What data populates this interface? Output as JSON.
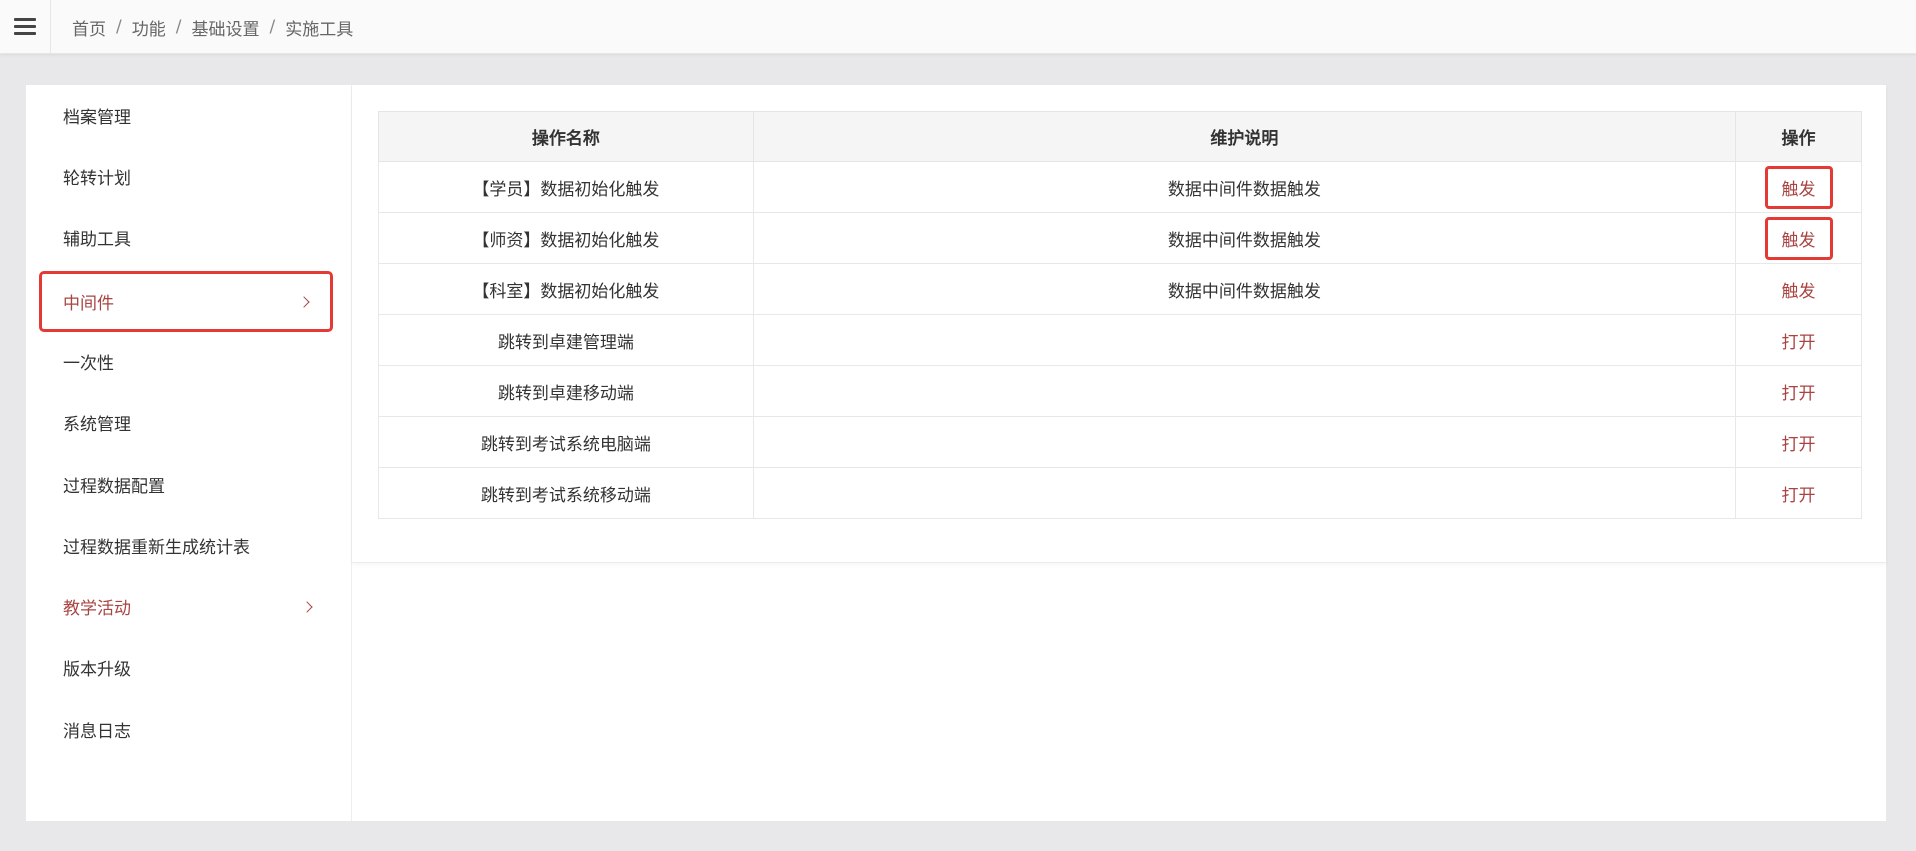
{
  "breadcrumb": {
    "items": [
      "首页",
      "功能",
      "基础设置"
    ],
    "current": "实施工具"
  },
  "sidebar": {
    "items": [
      {
        "label": "档案管理"
      },
      {
        "label": "轮转计划"
      },
      {
        "label": "辅助工具"
      },
      {
        "label": "中间件"
      },
      {
        "label": "一次性"
      },
      {
        "label": "系统管理"
      },
      {
        "label": "过程数据配置"
      },
      {
        "label": "过程数据重新生成统计表"
      },
      {
        "label": "教学活动"
      },
      {
        "label": "版本升级"
      },
      {
        "label": "消息日志"
      }
    ]
  },
  "table": {
    "headers": [
      "操作名称",
      "维护说明",
      "操作"
    ],
    "rows": [
      {
        "name": "【学员】数据初始化触发",
        "desc": "数据中间件数据触发",
        "action": "触发"
      },
      {
        "name": "【师资】数据初始化触发",
        "desc": "数据中间件数据触发",
        "action": "触发"
      },
      {
        "name": "【科室】数据初始化触发",
        "desc": "数据中间件数据触发",
        "action": "触发"
      },
      {
        "name": "跳转到卓建管理端",
        "desc": "",
        "action": "打开"
      },
      {
        "name": "跳转到卓建移动端",
        "desc": "",
        "action": "打开"
      },
      {
        "name": "跳转到考试系统电脑端",
        "desc": "",
        "action": "打开"
      },
      {
        "name": "跳转到考试系统移动端",
        "desc": "",
        "action": "打开"
      }
    ]
  },
  "colors": {
    "accent": "#a94442",
    "highlight_border": "#e53935",
    "page_bg": "#e8e8ea"
  },
  "icons": {
    "menu_toggle": "hamburger-icon",
    "submenu": "chevron-right-icon"
  }
}
